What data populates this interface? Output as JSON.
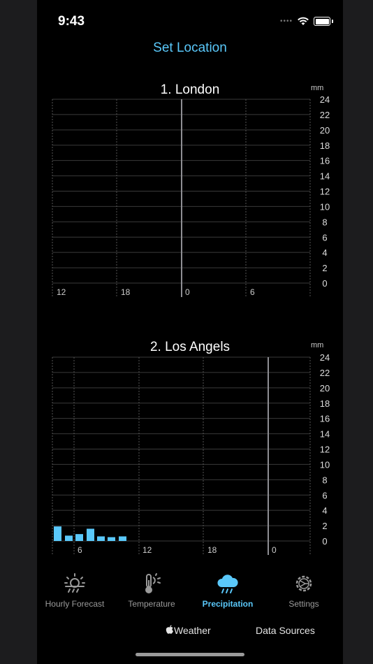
{
  "status_bar": {
    "time": "9:43"
  },
  "header": {
    "set_location_label": "Set Location"
  },
  "chart_data": [
    {
      "type": "bar",
      "title": "1. London",
      "ylabel": "mm",
      "ylim": [
        0,
        24
      ],
      "y_ticks": [
        "0",
        "2",
        "4",
        "6",
        "8",
        "10",
        "12",
        "14",
        "16",
        "18",
        "20",
        "22",
        "24"
      ],
      "x_tick_labels": [
        "12",
        "18",
        "0",
        "6"
      ],
      "now_marker": "0",
      "values": [],
      "grid": true
    },
    {
      "type": "bar",
      "title": "2. Los Angels",
      "ylabel": "mm",
      "ylim": [
        0,
        24
      ],
      "y_ticks": [
        "0",
        "2",
        "4",
        "6",
        "8",
        "10",
        "12",
        "14",
        "16",
        "18",
        "20",
        "22",
        "24"
      ],
      "x_tick_labels": [
        "6",
        "12",
        "18",
        "0"
      ],
      "now_marker": "0",
      "hours": [
        "4",
        "5",
        "6",
        "7",
        "8",
        "9",
        "10"
      ],
      "values": [
        1.9,
        0.7,
        0.9,
        1.6,
        0.6,
        0.5,
        0.6
      ],
      "color": "#5ac8fa",
      "grid": true
    }
  ],
  "tabbar": {
    "tabs": [
      {
        "label": "Hourly Forecast",
        "icon": "sun-rain-icon"
      },
      {
        "label": "Temperature",
        "icon": "thermometer-sun-icon"
      },
      {
        "label": "Precipitation",
        "icon": "cloud-rain-icon",
        "active": true
      },
      {
        "label": "Settings",
        "icon": "gear-icon"
      }
    ]
  },
  "footer": {
    "weather_label": "Weather",
    "data_sources_label": "Data Sources"
  },
  "colors": {
    "accent": "#5ac8fa",
    "background": "#000000",
    "grid": "#3a3a3a",
    "now_line": "#8e8e93"
  }
}
